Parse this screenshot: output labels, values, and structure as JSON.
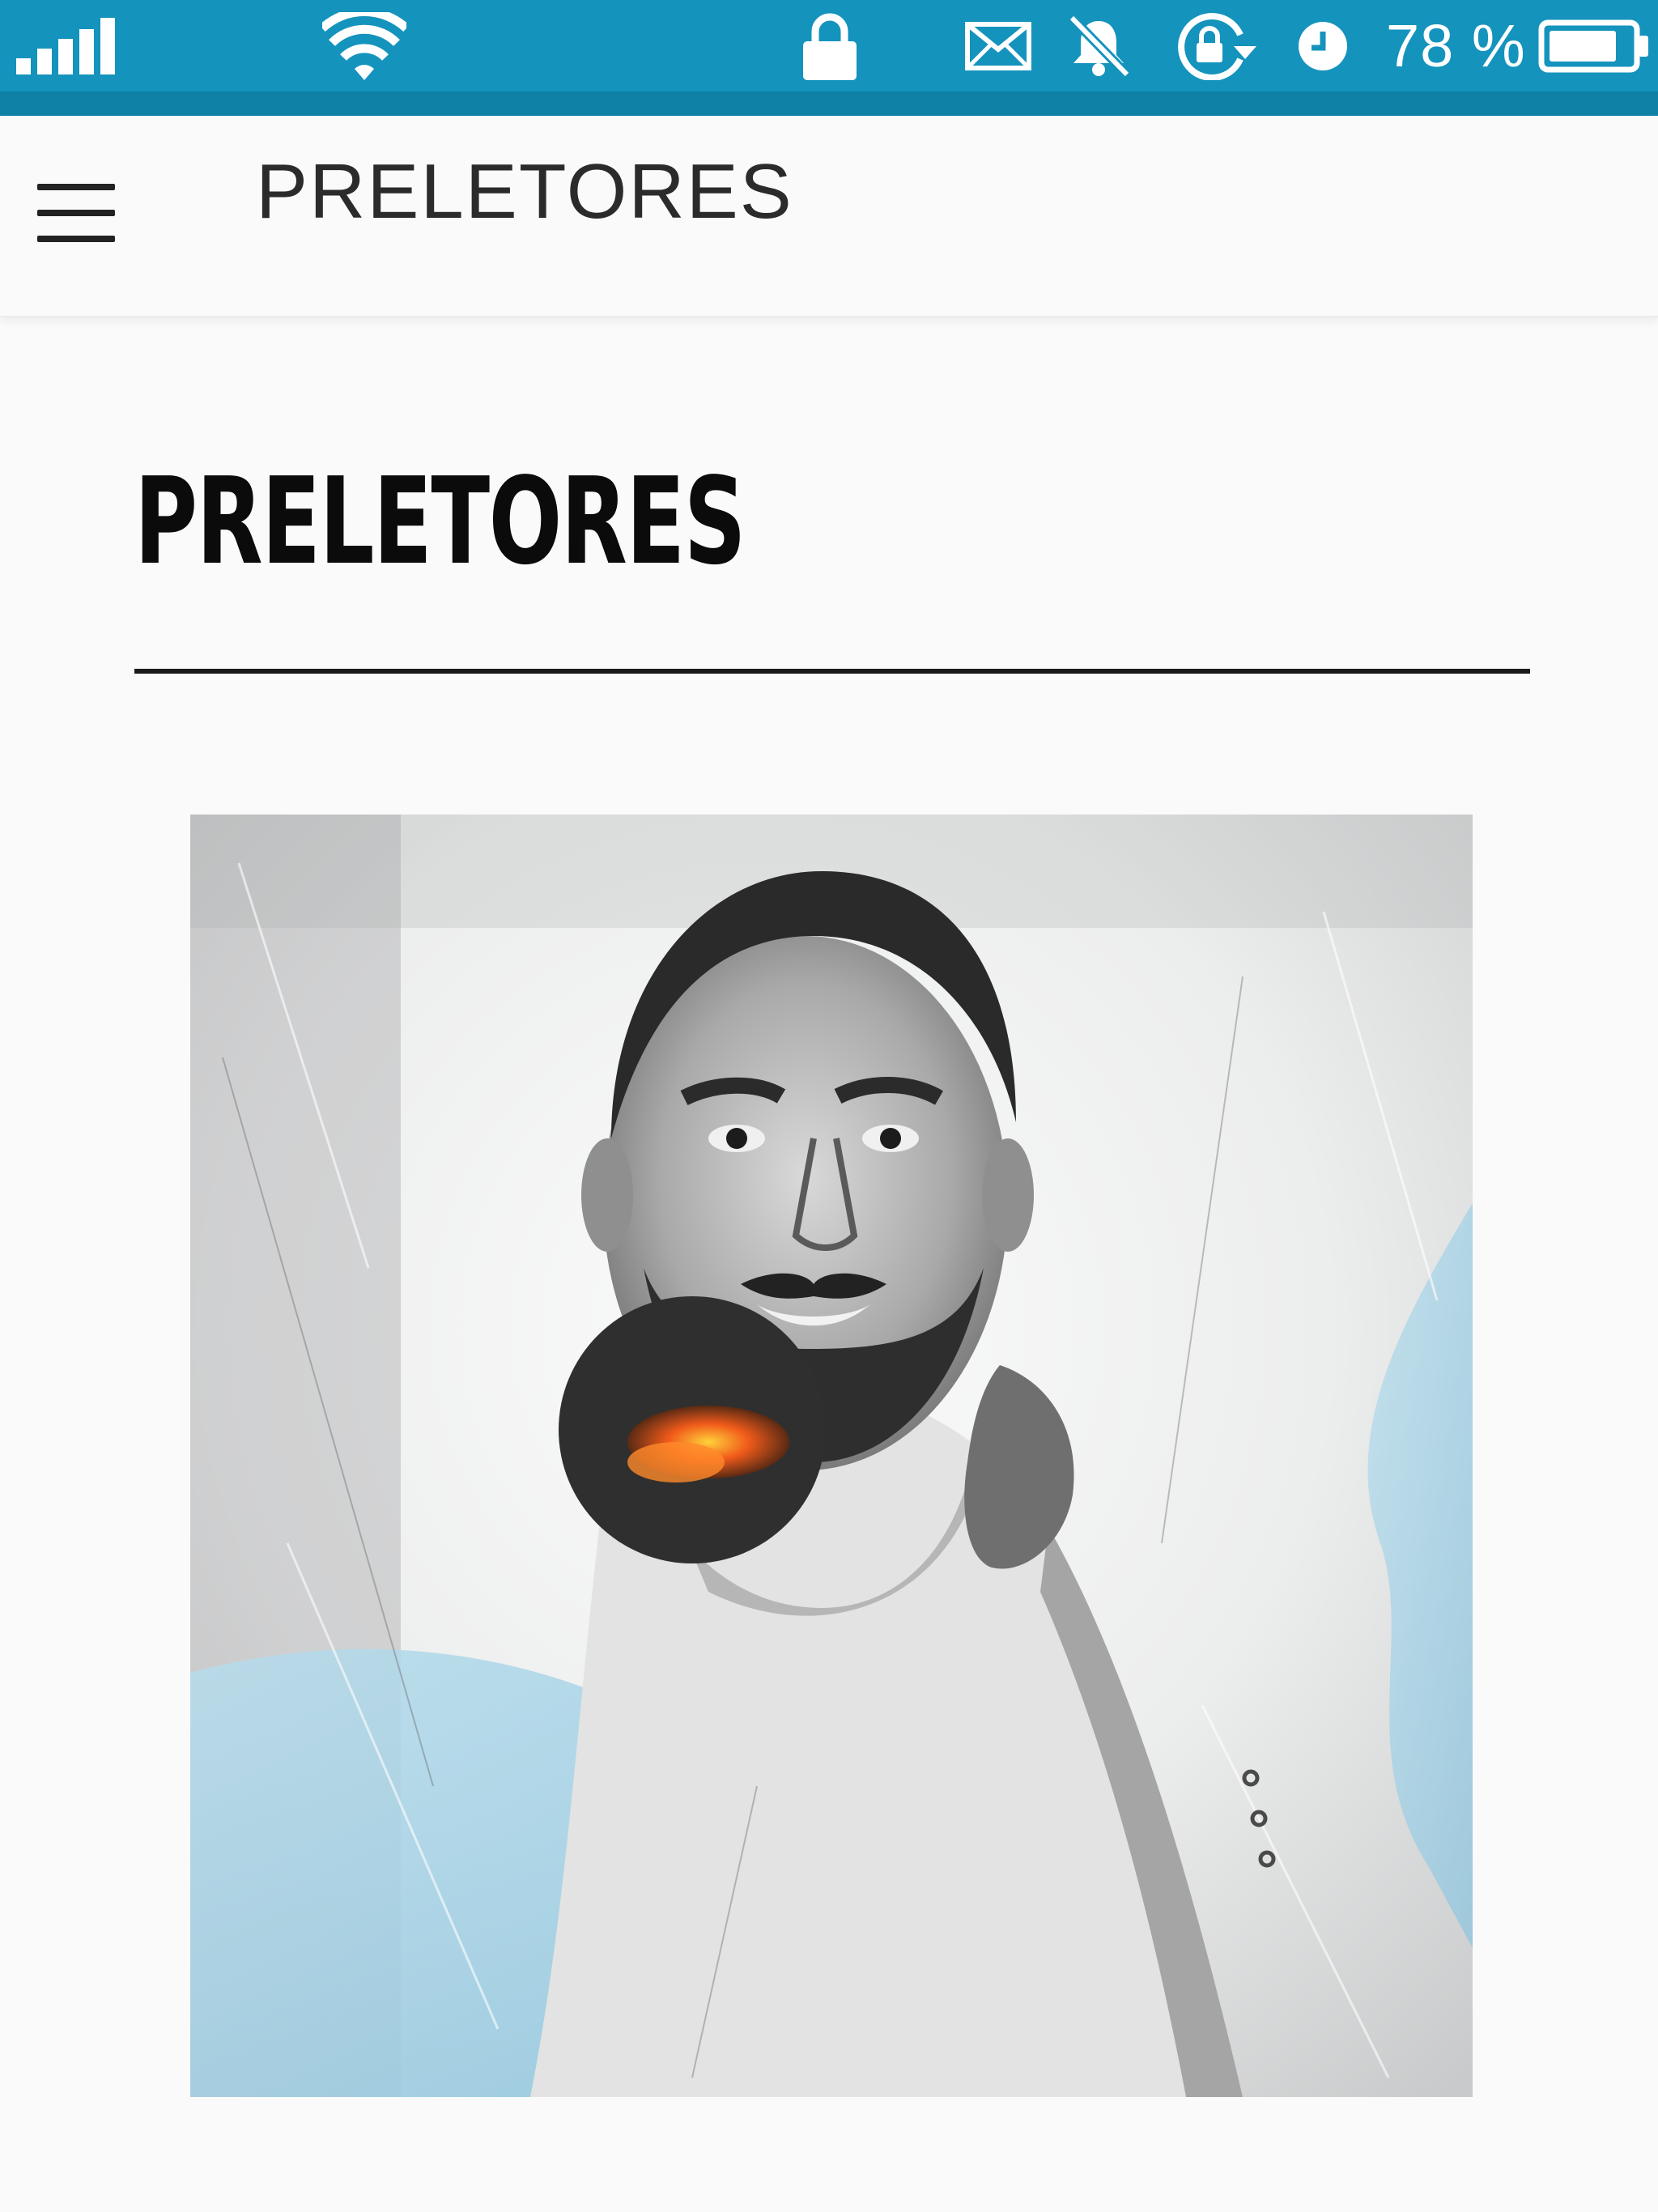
{
  "status_bar": {
    "battery_percent": "78 %",
    "icons": [
      "signal-icon",
      "wifi-icon",
      "lock-icon",
      "mail-icon",
      "bell-off-icon",
      "rotation-lock-icon",
      "alarm-clock-icon",
      "battery-icon"
    ],
    "colors": {
      "background": "#1493bd",
      "shadow": "#0f80a6"
    },
    "battery_level": 0.78
  },
  "app_bar": {
    "title": "PRELETORES",
    "menu_icon": "hamburger-menu-icon"
  },
  "page": {
    "heading": "PRELETORES"
  },
  "speaker": {
    "image_description_icon": "speaker-portrait",
    "colors": {
      "accent_blue": "#9fd0e6",
      "fire": "#f05a1a"
    }
  }
}
